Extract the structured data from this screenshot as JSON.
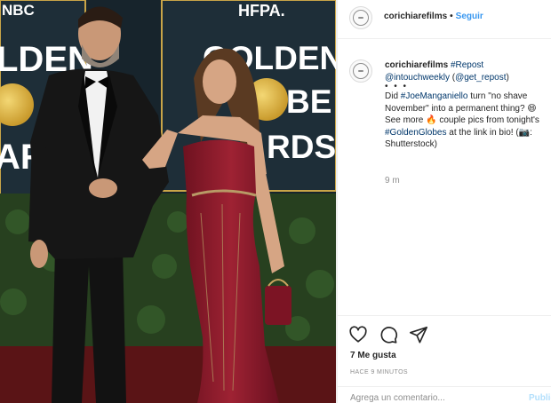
{
  "post": {
    "username": "corichiarefilms",
    "separator": "•",
    "follow_label": "Seguir"
  },
  "photo": {
    "banner_left_top": "NBC",
    "banner_left_lines": [
      "LDEN",
      "ARE"
    ],
    "banner_right_top": "HFPA.",
    "banner_right_lines": [
      "GOLDEN",
      "BE",
      "RDS"
    ],
    "colors": {
      "backdrop": "#1e2e38",
      "gold": "#d7b048",
      "dress": "#8e1b2a",
      "suit": "#121212",
      "hedge": "#27401f"
    }
  },
  "caption": {
    "username": "corichiarefilms",
    "repost_tag": "#Repost",
    "mention_a": "@intouchweekly",
    "mention_b": "@get_repost",
    "mention_b_open": "(",
    "mention_b_close": ")",
    "ellipsis": "• • •",
    "text_1": "Did ",
    "tag_1": "#JoeManganiello",
    "text_2": " turn \"no shave November\" into a permanent thing? 😄 See more 🔥 couple pics from tonight's ",
    "tag_2": "#GoldenGlobes",
    "text_3": " at the link in bio! (📷: Shutterstock)",
    "time": "9 m"
  },
  "actions": {
    "like_icon": "heart-icon",
    "comment_icon": "comment-icon",
    "share_icon": "share-icon",
    "likes": "7 Me gusta",
    "ago": "HACE 9 MINUTOS"
  },
  "comment_box": {
    "placeholder": "Agrega un comentario...",
    "publish_label": "Publicar"
  }
}
